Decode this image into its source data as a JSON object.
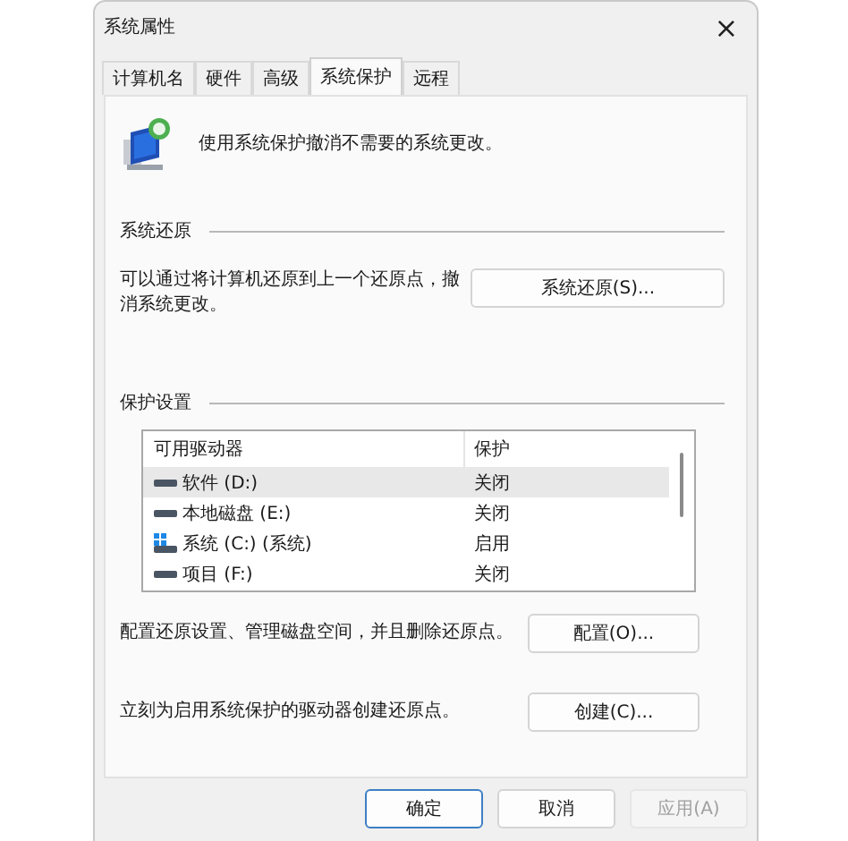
{
  "window": {
    "title": "系统属性",
    "close": "×"
  },
  "tabs": [
    {
      "label": "计算机名",
      "selected": false
    },
    {
      "label": "硬件",
      "selected": false
    },
    {
      "label": "高级",
      "selected": false
    },
    {
      "label": "系统保护",
      "selected": true
    },
    {
      "label": "远程",
      "selected": false
    }
  ],
  "intro": "使用系统保护撤消不需要的系统更改。",
  "restore": {
    "heading": "系统还原",
    "text": "可以通过将计算机还原到上一个还原点，撤消系统更改。",
    "button": "系统还原(S)..."
  },
  "protection": {
    "heading": "保护设置",
    "columns": [
      "可用驱动器",
      "保护"
    ],
    "rows": [
      {
        "kind": "drive",
        "name": "软件 (D:)",
        "status": "关闭",
        "selected": true
      },
      {
        "kind": "drive",
        "name": "本地磁盘 (E:)",
        "status": "关闭",
        "selected": false
      },
      {
        "kind": "system",
        "name": "系统 (C:) (系统)",
        "status": "启用",
        "selected": false
      },
      {
        "kind": "drive",
        "name": "项目 (F:)",
        "status": "关闭",
        "selected": false
      }
    ],
    "configure_text": "配置还原设置、管理磁盘空间，并且删除还原点。",
    "configure_button": "配置(O)...",
    "create_text": "立刻为启用系统保护的驱动器创建还原点。",
    "create_button": "创建(C)..."
  },
  "buttons": [
    {
      "label": "确定",
      "kind": "default",
      "disabled": false
    },
    {
      "label": "取消",
      "kind": "normal",
      "disabled": false
    },
    {
      "label": "应用(A)",
      "kind": "normal",
      "disabled": true
    }
  ]
}
